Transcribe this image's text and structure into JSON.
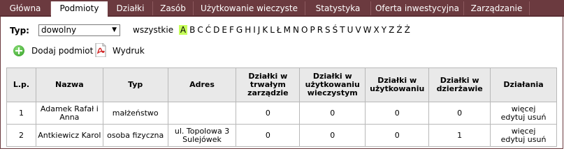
{
  "nav": {
    "tabs": [
      "Główna",
      "Podmioty",
      "Działki",
      "Zasób",
      "Użytkowanie wieczyste",
      "Statystyka",
      "Oferta inwestycyjna",
      "Zarządzanie"
    ],
    "active": "Podmioty"
  },
  "filter": {
    "typ_label": "Typ:",
    "select_value": "dowolny",
    "all_label": "wszystkie",
    "letters": [
      "A",
      "B",
      "C",
      "Ć",
      "D",
      "E",
      "F",
      "G",
      "H",
      "I",
      "J",
      "K",
      "L",
      "Ł",
      "M",
      "N",
      "O",
      "P",
      "R",
      "S",
      "Ś",
      "T",
      "U",
      "V",
      "W",
      "X",
      "Y",
      "Z",
      "Ź",
      "Ż"
    ],
    "active_letter": "A"
  },
  "actions": {
    "add": "Dodaj podmiot",
    "print": "Wydruk"
  },
  "table": {
    "headers": [
      "L.p.",
      "Nazwa",
      "Typ",
      "Adres",
      "Działki w trwałym zarządzie",
      "Działki w użytkowaniu wieczystym",
      "Działki w użytkowaniu",
      "Działki w dzierżawie",
      "Działania"
    ],
    "rows": [
      {
        "lp": "1",
        "nazwa": "Adamek Rafał i Anna",
        "typ": "małżeństwo",
        "adres": "",
        "trwaly": "0",
        "wieczysty": "0",
        "uzytkowanie": "0",
        "dzierzawa": "0",
        "more": "więcej",
        "edit": "edytuj",
        "delete": "usuń"
      },
      {
        "lp": "2",
        "nazwa": "Antkiewicz Karol",
        "typ": "osoba fizyczna",
        "adres": "ul. Topolowa 3 Sulejówek",
        "trwaly": "0",
        "wieczysty": "0",
        "uzytkowanie": "0",
        "dzierzawa": "1",
        "more": "więcej",
        "edit": "edytuj",
        "delete": "usuń"
      }
    ]
  },
  "colors": {
    "nav_bg": "#6b3a3f",
    "header_bg": "#e9e9e9",
    "active_letter_bg": "#c6ff5a"
  }
}
